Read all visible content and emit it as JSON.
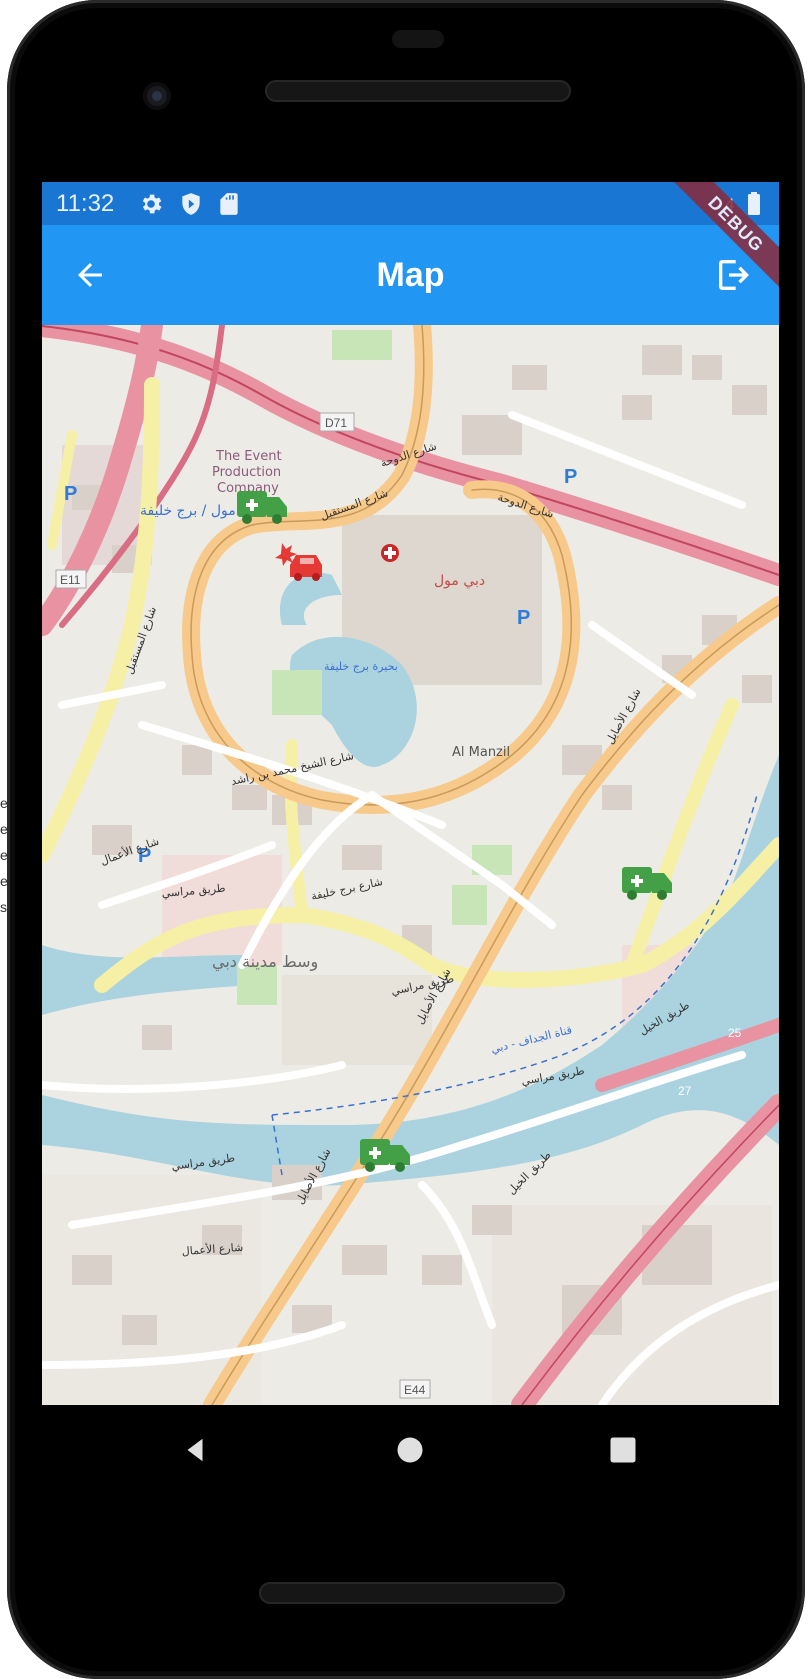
{
  "side_text": [
    "e",
    "e",
    "e",
    "e",
    "s"
  ],
  "status_bar": {
    "time": "11:32",
    "icons": [
      "settings-icon",
      "shield-icon",
      "sd-card-icon",
      "signal-icon",
      "battery-icon"
    ],
    "signal_glyph": "4"
  },
  "app_bar": {
    "title": "Map",
    "back_icon": "arrow-back-icon",
    "logout_icon": "logout-icon",
    "color": "#2196f3",
    "status_color": "#1976d2"
  },
  "debug_banner": "DEBUG",
  "map": {
    "labels": {
      "event_company_1": "The Event",
      "event_company_2": "Production",
      "event_company_3": "Company",
      "dubai_mall_ar": "دبي مول",
      "burj_lake_ar": "بحيرة برج خليفة",
      "al_manzil": "Al Manzil",
      "downtown_ar": "وسط مدينة دبي",
      "dubai_mall_metro_ar": "دبي مول / برج خليفة",
      "road_d71": "D71",
      "road_e11": "E11",
      "road_e44": "E44",
      "road_25": "25",
      "road_27": "27",
      "doha_st_ar": "شارع الدوحة",
      "mustaqbal_st_ar": "شارع المستقبل",
      "sheikh_mohammed_ar": "شارع الشيخ محمد بن راشد",
      "asayel_st_ar": "شارع الأصايل",
      "marasi_st_ar": "طريق مراسي",
      "khail_rd_ar": "طريق الخيل",
      "jaddaf_canal_ar": "قناة الجداف - دبي",
      "burj_khalifa_st_ar": "شارع برج خليفة",
      "amal_st_ar": "شارع الأعمال",
      "parking": "P"
    },
    "markers": [
      {
        "type": "ambulance",
        "color": "#43a047"
      },
      {
        "type": "accident-car",
        "color": "#e53935"
      },
      {
        "type": "hospital",
        "color": "#c62828"
      },
      {
        "type": "ambulance",
        "color": "#43a047"
      },
      {
        "type": "ambulance",
        "color": "#43a047"
      }
    ]
  },
  "nav_bar": {
    "back": "nav-back-icon",
    "home": "nav-home-icon",
    "recents": "nav-recents-icon"
  }
}
